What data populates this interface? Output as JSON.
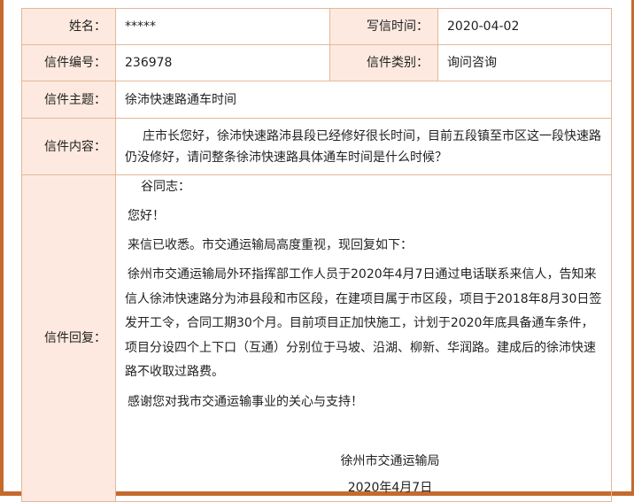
{
  "fields": {
    "name_label": "姓名：",
    "name_value": "*****",
    "time_label": "写信时间：",
    "time_value": "2020-04-02",
    "number_label": "信件编号：",
    "number_value": "236978",
    "type_label": "信件类别：",
    "type_value": "询问咨询",
    "subject_label": "信件主题：",
    "subject_value": "徐沛快速路通车时间",
    "content_label": "信件内容：",
    "content_value": "庄市长您好，徐沛快速路沛县段已经修好很长时间，目前五段镇至市区这一段快速路仍没修好，请问整条徐沛快速路具体通车时间是什么时候？",
    "reply_label": "信件回复："
  },
  "reply": {
    "salutation": "谷同志：",
    "greeting": "您好！",
    "intro": "来信已收悉。市交通运输局高度重视，现回复如下：",
    "body": "徐州市交通运输局外环指挥部工作人员于2020年4月7日通过电话联系来信人，告知来信人徐沛快速路分为沛县段和市区段，在建项目属于市区段，项目于2018年8月30日签发开工令，合同工期30个月。目前项目正加快施工，计划于2020年底具备通车条件，项目分设四个上下口（互通）分别位于马坡、沿湖、柳新、华润路。建成后的徐沛快速路不收取过路费。",
    "thanks": "感谢您对我市交通运输事业的关心与支持！",
    "signature": "徐州市交通运输局",
    "date": "2020年4月7日"
  },
  "colors": {
    "label_bg": "#fde9df",
    "border": "#e4b89a",
    "frame_edge": "#c56a2d"
  }
}
